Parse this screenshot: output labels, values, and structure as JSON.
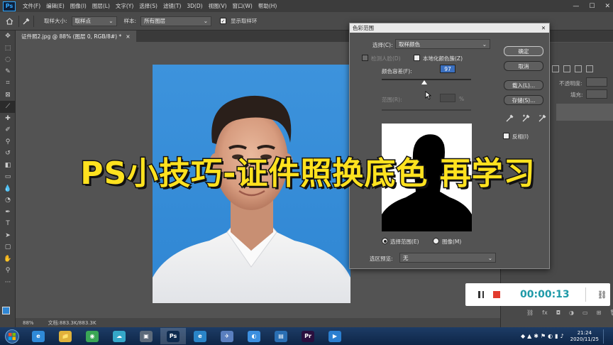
{
  "menubar": {
    "logo": "Ps",
    "items": [
      "文件(F)",
      "编辑(E)",
      "图像(I)",
      "图层(L)",
      "文字(Y)",
      "选择(S)",
      "滤镜(T)",
      "3D(D)",
      "视图(V)",
      "窗口(W)",
      "帮助(H)"
    ],
    "window_controls": [
      "—",
      "☐",
      "✕"
    ]
  },
  "options": {
    "sample_size_label": "取样大小:",
    "sample_size_value": "取样点",
    "sample_label": "样本:",
    "sample_value": "所有图层",
    "show_ring_label": "显示取样环"
  },
  "document": {
    "tab_title": "证件照2.jpg @ 88% (图层 0, RGB/8#) *",
    "tab_close": "×"
  },
  "status": {
    "zoom": "88%",
    "doc_size": "文档:883.3K/883.3K"
  },
  "right_panel": {
    "opacity_label": "不透明度:",
    "fill_label": "填充:"
  },
  "dialog": {
    "title": "色彩范围",
    "select_label": "选择(C):",
    "select_value": "取样颜色",
    "detect_faces": "检测人脸(D)",
    "localized": "本地化颜色簇(Z)",
    "fuzziness_label": "颜色容差(F):",
    "fuzziness_value": "97",
    "range_label": "范围(R):",
    "range_unit": "%",
    "ok": "确定",
    "cancel": "取消",
    "load": "载入(L)...",
    "save": "存储(S)...",
    "invert": "反相(I)",
    "selection_radio": "选择范围(E)",
    "image_radio": "图像(M)",
    "preview_label": "选区预览:",
    "preview_value": "无",
    "fuzziness_fraction": 0.48,
    "colors": {
      "title_bg": "#e9e9e9",
      "body_bg": "#535353"
    }
  },
  "banner": {
    "text": "PS小技巧-证件照换底色 再学习",
    "color": "#ffe21f"
  },
  "recorder": {
    "time": "00:00:13",
    "pause_icon": "pause-icon",
    "stop_icon": "stop-icon",
    "color": "#1f9aa8",
    "stop_color": "#e23b2e"
  },
  "taskbar": {
    "apps": [
      {
        "name": "ie-icon",
        "label": "e",
        "color": "#2f8ad8"
      },
      {
        "name": "explorer-icon",
        "label": "📁",
        "color": "#e0b23a"
      },
      {
        "name": "browser-icon",
        "label": "◉",
        "color": "#3aa655"
      },
      {
        "name": "cloud-icon",
        "label": "☁",
        "color": "#35a8c9"
      },
      {
        "name": "recorder-app-icon",
        "label": "▣",
        "color": "#5c6a7a"
      },
      {
        "name": "photoshop-icon",
        "label": "Ps",
        "color": "#0d2a4e"
      },
      {
        "name": "edge-icon",
        "label": "e",
        "color": "#2a85c8"
      },
      {
        "name": "feather-icon",
        "label": "✈",
        "color": "#5a7fbf"
      },
      {
        "name": "qq-browser-icon",
        "label": "◐",
        "color": "#3c8fe0"
      },
      {
        "name": "store-icon",
        "label": "▤",
        "color": "#2a6fb3"
      },
      {
        "name": "premiere-icon",
        "label": "Pr",
        "color": "#2a0f3e"
      },
      {
        "name": "camera-icon",
        "label": "▶",
        "color": "#2b7fd0"
      }
    ],
    "time": "21:24",
    "date": "2020/11/25"
  }
}
